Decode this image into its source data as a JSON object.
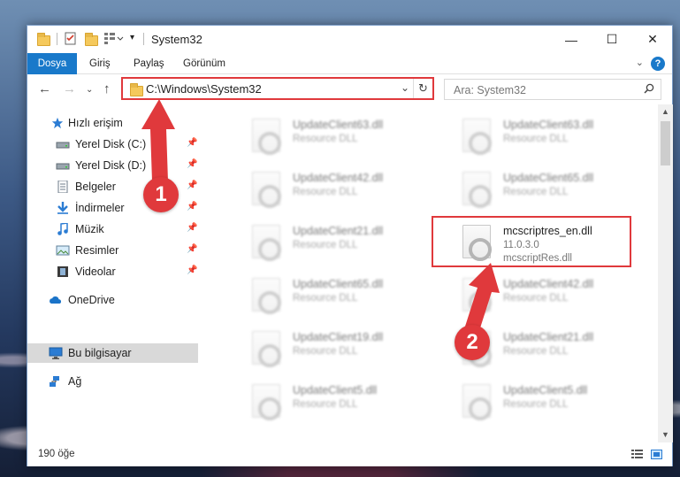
{
  "window": {
    "title": "System32",
    "controls": {
      "minimize": "—",
      "maximize": "☐",
      "close": "✕"
    }
  },
  "ribbon": {
    "tabs": [
      "Dosya",
      "Giriş",
      "Paylaş",
      "Görünüm"
    ],
    "help_icon": "?"
  },
  "address_bar": {
    "path": "C:\\Windows\\System32",
    "dropdown_icon": "chevron-down-icon",
    "refresh_icon": "↻"
  },
  "search": {
    "placeholder": "Ara: System32"
  },
  "sidebar": {
    "items": [
      {
        "label": "Hızlı erişim",
        "icon": "star-icon",
        "pinned": false
      },
      {
        "label": "Yerel Disk (C:)",
        "icon": "drive-icon",
        "pinned": true
      },
      {
        "label": "Yerel Disk (D:)",
        "icon": "drive-icon",
        "pinned": true
      },
      {
        "label": "Belgeler",
        "icon": "documents-icon",
        "pinned": true
      },
      {
        "label": "İndirmeler",
        "icon": "download-icon",
        "pinned": true
      },
      {
        "label": "Müzik",
        "icon": "music-icon",
        "pinned": true
      },
      {
        "label": "Resimler",
        "icon": "pictures-icon",
        "pinned": true
      },
      {
        "label": "Videolar",
        "icon": "videos-icon",
        "pinned": true
      },
      {
        "label": "OneDrive",
        "icon": "cloud-icon",
        "pinned": false
      },
      {
        "label": "Bu bilgisayar",
        "icon": "computer-icon",
        "pinned": false
      },
      {
        "label": "Ağ",
        "icon": "network-icon",
        "pinned": false
      }
    ],
    "pin_glyph": "📌"
  },
  "files": {
    "items": [
      {
        "name": "UpdateClient63.dll",
        "sub1": "Resource DLL",
        "sub2": ""
      },
      {
        "name": "UpdateClient63.dll",
        "sub1": "Resource DLL",
        "sub2": ""
      },
      {
        "name": "UpdateClient42.dll",
        "sub1": "Resource DLL",
        "sub2": ""
      },
      {
        "name": "UpdateClient65.dll",
        "sub1": "Resource DLL",
        "sub2": ""
      },
      {
        "name": "UpdateClient21.dll",
        "sub1": "Resource DLL",
        "sub2": ""
      },
      {
        "name": "mcscriptres_en.dll",
        "sub1": "11.0.3.0",
        "sub2": "mcscriptRes.dll"
      },
      {
        "name": "UpdateClient65.dll",
        "sub1": "Resource DLL",
        "sub2": ""
      },
      {
        "name": "UpdateClient42.dll",
        "sub1": "Resource DLL",
        "sub2": ""
      },
      {
        "name": "UpdateClient19.dll",
        "sub1": "Resource DLL",
        "sub2": ""
      },
      {
        "name": "UpdateClient21.dll",
        "sub1": "Resource DLL",
        "sub2": ""
      },
      {
        "name": "UpdateClient5.dll",
        "sub1": "Resource DLL",
        "sub2": ""
      },
      {
        "name": "UpdateClient5.dll",
        "sub1": "Resource DLL",
        "sub2": ""
      }
    ]
  },
  "status": {
    "item_count": "190 öğe"
  },
  "callouts": {
    "step1": "1",
    "step2": "2"
  },
  "colors": {
    "accent": "#1979ca",
    "highlight": "#e0393c",
    "selected": "#d9d9d9"
  }
}
